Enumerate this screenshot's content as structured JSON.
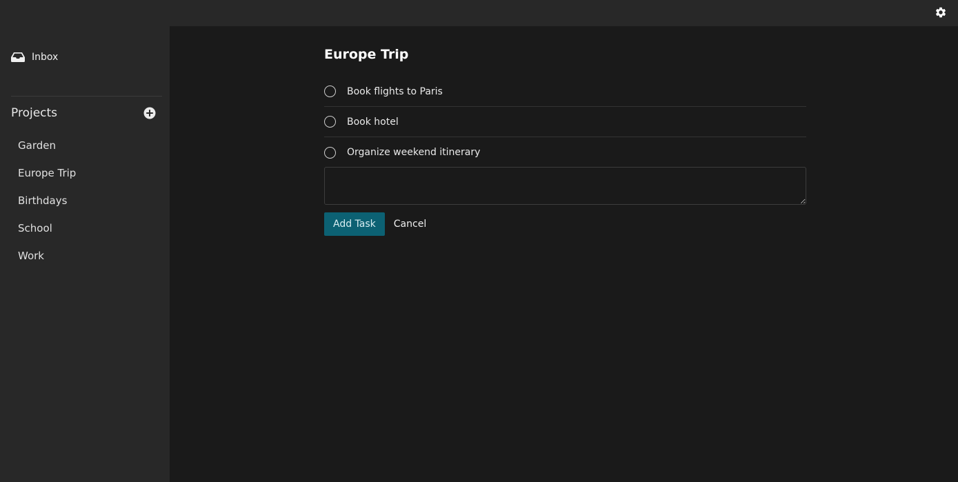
{
  "header": {
    "settings_icon": "gear-icon"
  },
  "sidebar": {
    "inbox": {
      "label": "Inbox",
      "icon": "inbox-icon"
    },
    "projects": {
      "title": "Projects",
      "add_icon": "plus-circle-icon",
      "items": [
        {
          "label": "Garden"
        },
        {
          "label": "Europe Trip"
        },
        {
          "label": "Birthdays"
        },
        {
          "label": "School"
        },
        {
          "label": "Work"
        }
      ]
    }
  },
  "main": {
    "title": "Europe Trip",
    "tasks": [
      {
        "label": "Book flights to Paris",
        "done": false
      },
      {
        "label": "Book hotel",
        "done": false
      },
      {
        "label": "Organize weekend itinerary",
        "done": false
      }
    ],
    "new_task_input": {
      "value": ""
    },
    "add_task_label": "Add Task",
    "cancel_label": "Cancel"
  },
  "colors": {
    "background": "#1a1a1a",
    "sidebar": "#282828",
    "accent": "#0c6173"
  }
}
